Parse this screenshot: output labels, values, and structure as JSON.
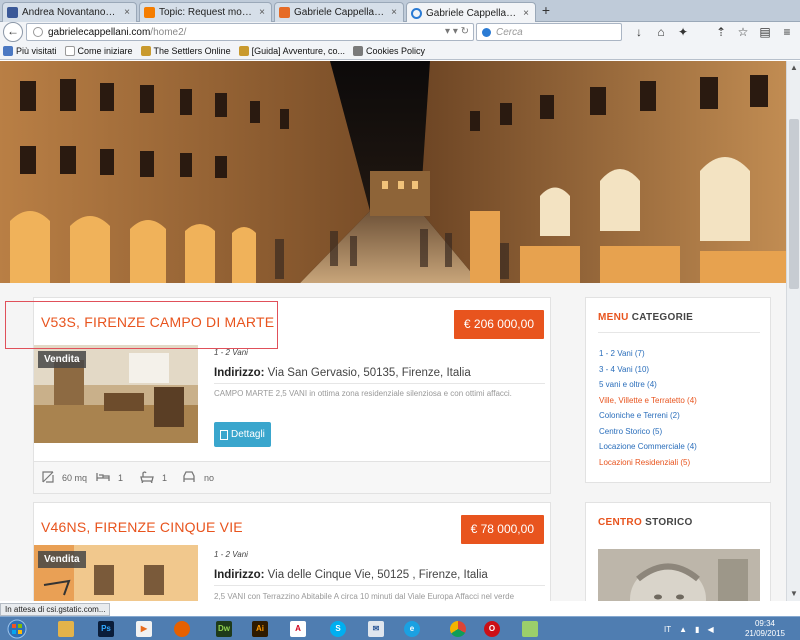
{
  "tabs": [
    {
      "label": "Andrea Novantanove Bini",
      "favicon_color": "#3b5998"
    },
    {
      "label": "Topic: Request more detail...",
      "favicon_color": "#f57d00"
    },
    {
      "label": "Gabriele Cappellani - Inter...",
      "favicon_color": "#e66b26"
    },
    {
      "label": "Gabriele Cappellani - Inter...",
      "favicon_color": "#2b7bd4"
    }
  ],
  "close_glyph": "×",
  "newtab_glyph": "+",
  "url": {
    "host": "gabrielecappellani.com",
    "path": "/home2/"
  },
  "search_placeholder": "Cerca",
  "bookmarks": [
    {
      "label": "Più visitati"
    },
    {
      "label": "Come iniziare"
    },
    {
      "label": "The Settlers Online"
    },
    {
      "label": "[Guida] Avventure, co..."
    },
    {
      "label": "Cookies Policy"
    }
  ],
  "listings": [
    {
      "title": "V53S, FIRENZE CAMPO DI MARTE",
      "price": "€ 206 000,00",
      "badge": "Vendita",
      "rooms": "1 - 2 Vani",
      "address_label": "Indirizzo:",
      "address": "Via San Gervasio, 50135, Firenze, Italia",
      "description": "CAMPO MARTE 2,5 VANI in ottima zona residenziale silenziosa e con ottimi affacci.",
      "details_label": "Dettagli",
      "features": {
        "area": "60 mq",
        "bedrooms": "1",
        "bathrooms": "1",
        "garage": "no"
      }
    },
    {
      "title": "V46NS, FIRENZE CINQUE VIE",
      "price": "€ 78 000,00",
      "badge": "Vendita",
      "rooms": "1 - 2 Vani",
      "address_label": "Indirizzo:",
      "address": "Via delle Cinque Vie, 50125 , Firenze, Italia",
      "description": "2,5 VANI con Terrazzino Abitabile A circa 10 minuti dal Viale Europa Affacci nel verde"
    }
  ],
  "sidebar": {
    "menu_accent": "MENU",
    "menu_title": "CATEGORIE",
    "categories": [
      {
        "label": "1 - 2 Vani (7)"
      },
      {
        "label": "3 - 4 Vani (10)"
      },
      {
        "label": "5 vani e oltre (4)"
      },
      {
        "label": "Ville, Villette e Terratetto (4)"
      },
      {
        "label": "Coloniche e Terreni (2)"
      },
      {
        "label": "Centro Storico (5)"
      },
      {
        "label": "Locazione Commerciale (4)"
      },
      {
        "label": "Locazioni Residenziali (5)"
      }
    ],
    "centro_accent": "CENTRO",
    "centro_title": "STORICO"
  },
  "status_text": "In attesa di csi.gstatic.com...",
  "taskbar": {
    "apps": [
      "Windows Explorer",
      "Photoshop",
      "Media Player",
      "Firefox",
      "Dreamweaver",
      "Illustrator",
      "Acrobat",
      "Skype",
      "Outlook",
      "Internet Explorer",
      "Chrome",
      "Opera",
      "Notepad++"
    ],
    "lang": "IT",
    "time": "09:34",
    "date": "21/09/2015"
  },
  "colors": {
    "accent": "#e8541e",
    "link": "#2a6ebb",
    "button": "#3aa6cd",
    "highlight": "#e0505a"
  }
}
